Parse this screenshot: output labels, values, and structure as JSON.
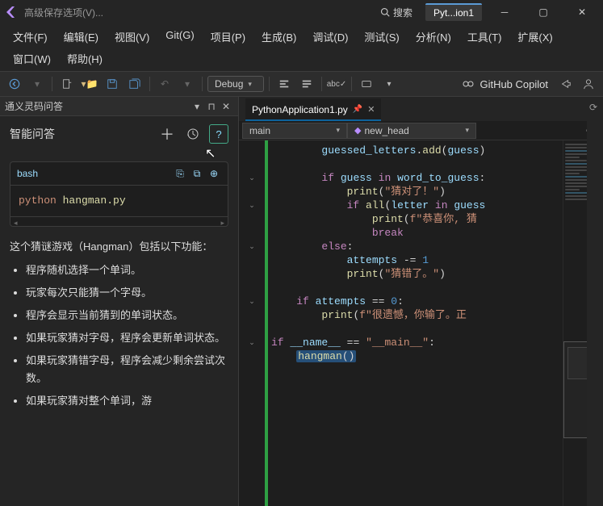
{
  "titlebar": {
    "app_label": "高级保存选项(V)...",
    "search_label": "搜索",
    "doc_tab": "Pyt...ion1"
  },
  "menus": {
    "row": [
      "文件(F)",
      "编辑(E)",
      "视图(V)",
      "Git(G)",
      "项目(P)",
      "生成(B)",
      "调试(D)",
      "测试(S)",
      "分析(N)",
      "工具(T)",
      "扩展(X)",
      "窗口(W)",
      "帮助(H)"
    ]
  },
  "toolbar": {
    "config": "Debug",
    "copilot": "GitHub Copilot"
  },
  "panel": {
    "window_title": "通义灵码问答",
    "title": "智能问答",
    "code_lang": "bash",
    "code_cmd_1": "python",
    "code_cmd_2": "hangman.py",
    "desc_intro": "这个猜谜游戏（Hangman）包括以下功能：",
    "features": [
      "程序随机选择一个单词。",
      "玩家每次只能猜一个字母。",
      "程序会显示当前猜到的单词状态。",
      "如果玩家猜对字母，程序会更新单词状态。",
      "如果玩家猜错字母，程序会减少剩余尝试次数。",
      "如果玩家猜对整个单词，游"
    ]
  },
  "editor": {
    "tab_name": "PythonApplication1.py",
    "crumb_scope": "main",
    "crumb_member": "new_head",
    "code_lines": [
      "        guessed_letters.add(guess)",
      "",
      "        if guess in word_to_guess:",
      "            print(\"猜对了！\")",
      "            if all(letter in guess",
      "                print(f\"恭喜你, 猜",
      "                break",
      "        else:",
      "            attempts -= 1",
      "            print(\"猜错了。\")",
      "",
      "    if attempts == 0:",
      "        print(f\"很遗憾，你输了。正",
      "",
      "if __name__ == \"__main__\":",
      "    hangman()"
    ]
  }
}
